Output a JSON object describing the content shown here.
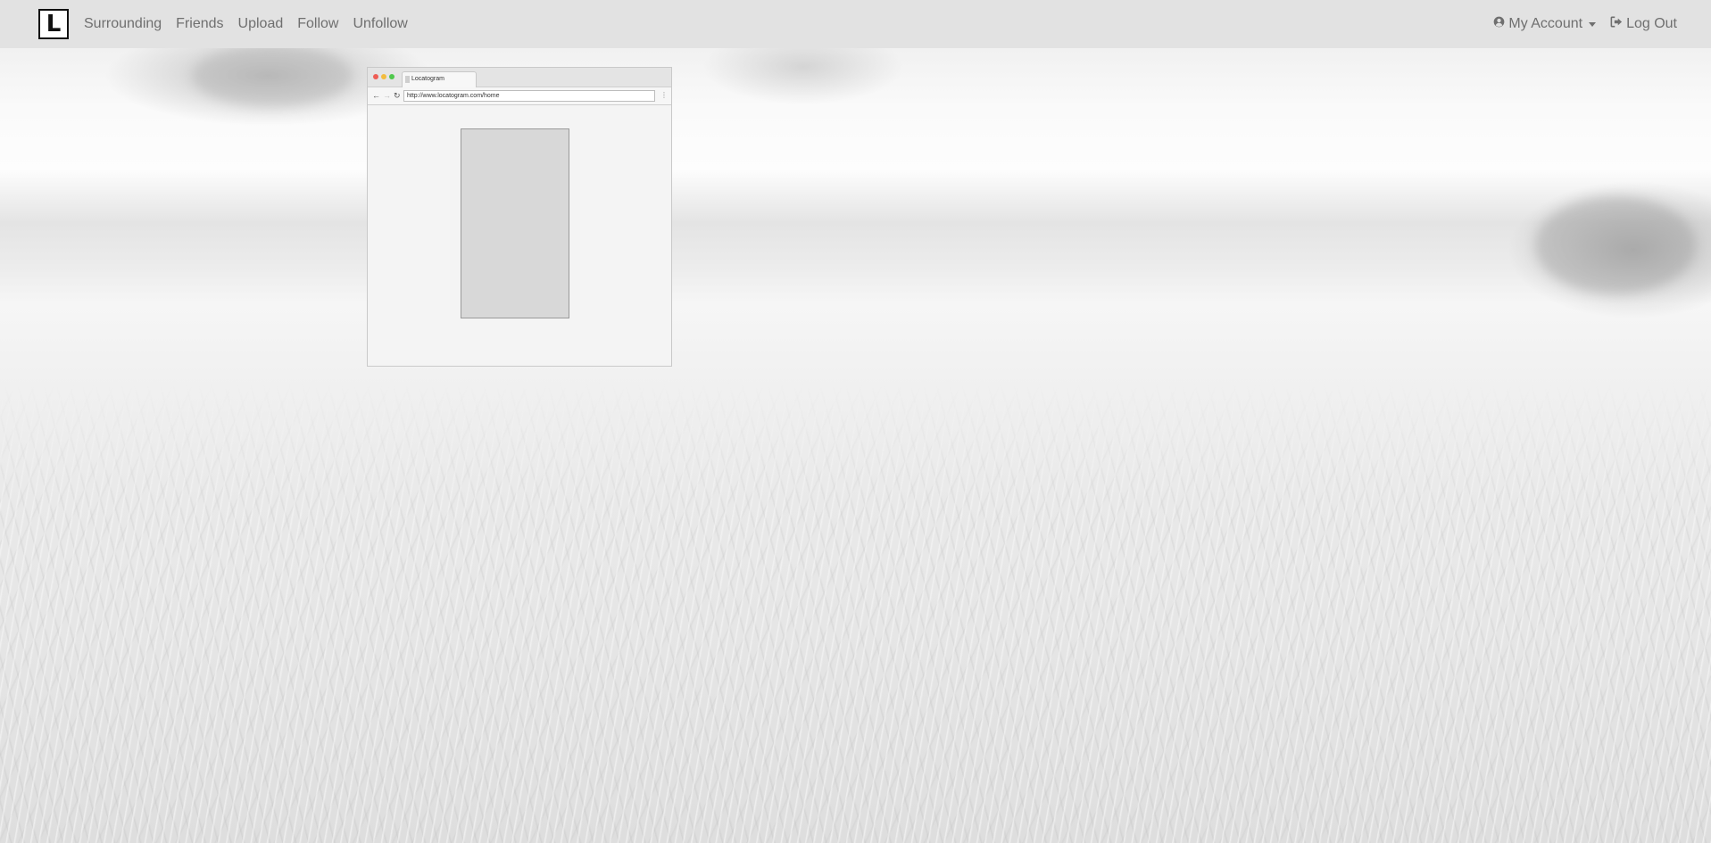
{
  "navbar": {
    "logo_text": "L",
    "links": [
      {
        "label": "Surrounding"
      },
      {
        "label": "Friends"
      },
      {
        "label": "Upload"
      },
      {
        "label": "Follow"
      },
      {
        "label": "Unfollow"
      }
    ],
    "account": {
      "label": "My Account",
      "icon": "user-circle-icon"
    },
    "logout": {
      "label": "Log Out",
      "icon": "sign-out-icon"
    },
    "background_color": "#e2e2e2",
    "text_color": "#6f6f6f"
  },
  "mockup": {
    "tab_title": "Locatogram",
    "url": "http://www.locatogram.com/home",
    "window_controls": [
      "close",
      "minimize",
      "maximize"
    ]
  },
  "background": {
    "description_color": "#f0f0f0"
  }
}
